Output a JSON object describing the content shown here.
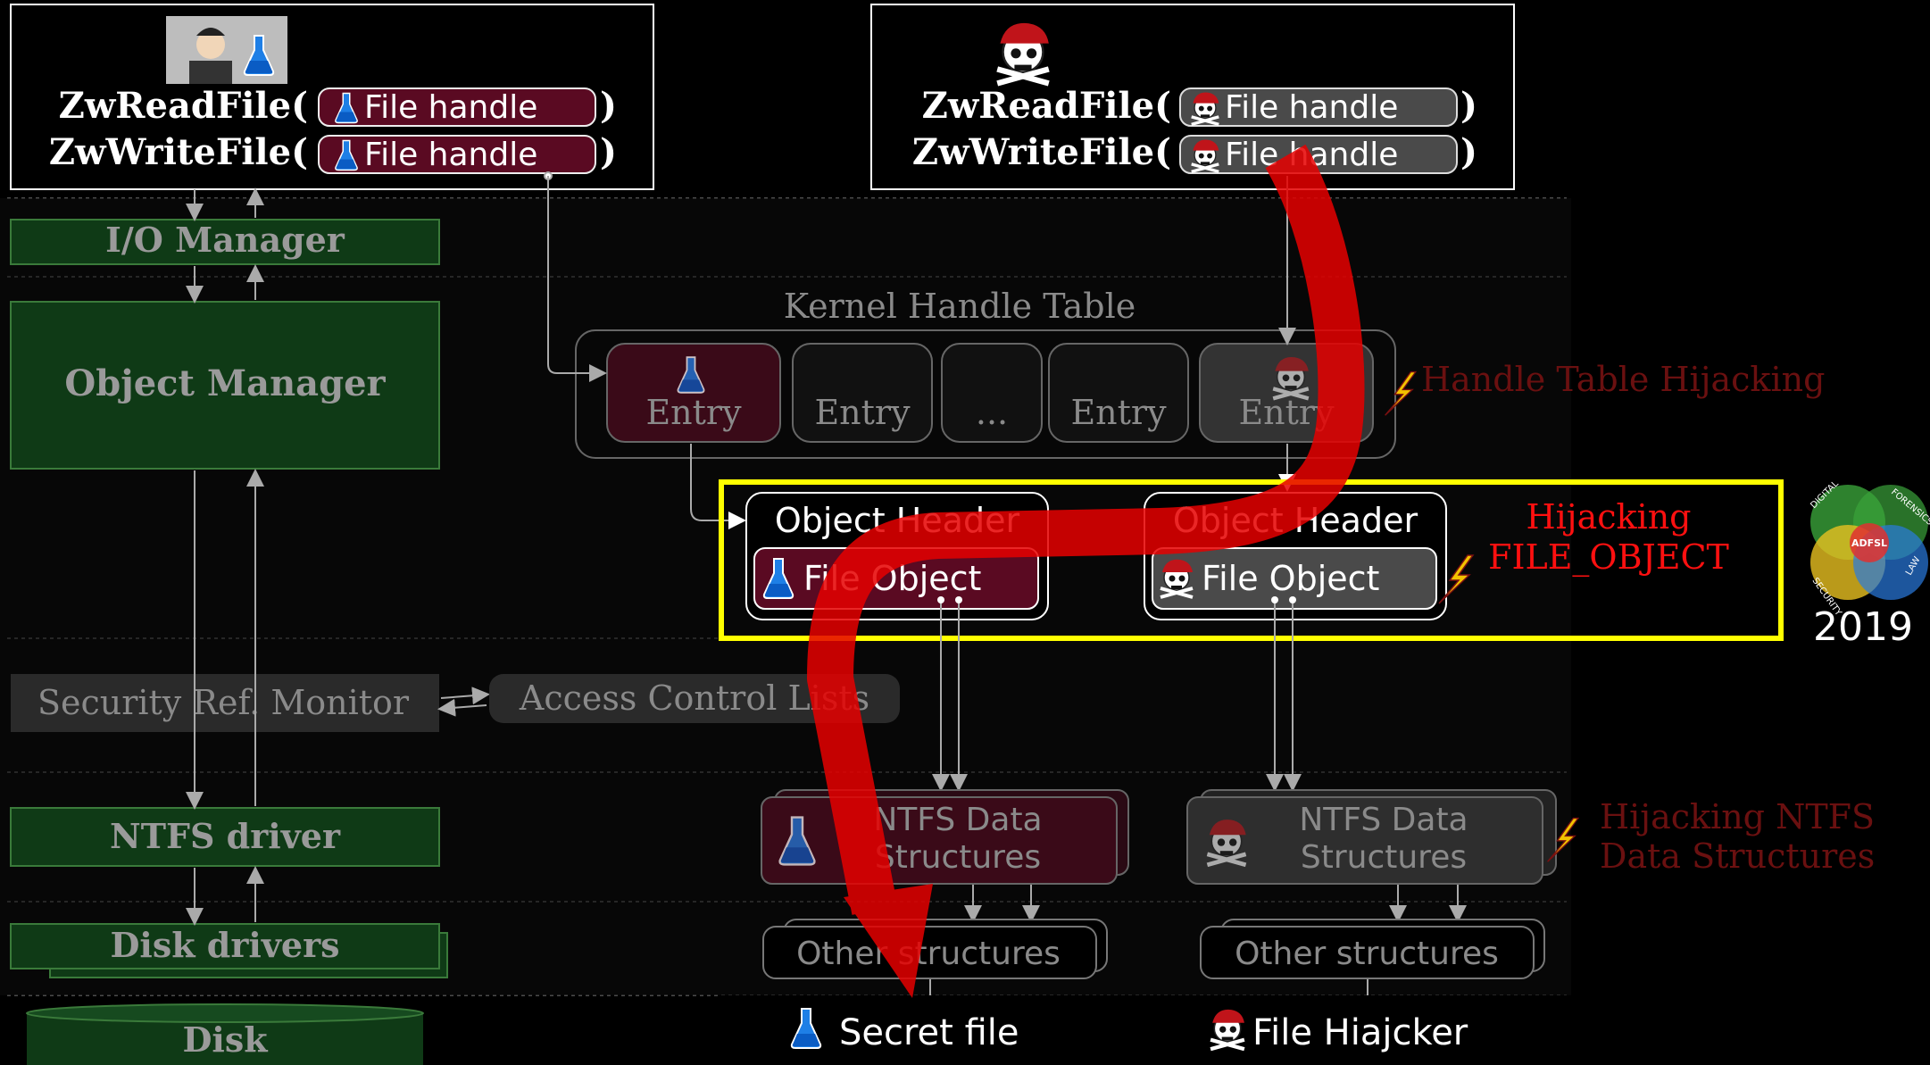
{
  "legit": {
    "read_call": "ZwReadFile(",
    "write_call": "ZwWriteFile(",
    "handle_label": "File handle",
    "close_paren": ")"
  },
  "attacker": {
    "read_call": "ZwReadFile(",
    "write_call": "ZwWriteFile(",
    "handle_label": "File handle",
    "close_paren": ")"
  },
  "layers": {
    "io_manager": "I/O Manager",
    "object_manager": "Object Manager",
    "security_monitor": "Security Ref. Monitor",
    "acl": "Access Control Lists",
    "ntfs_driver": "NTFS driver",
    "disk_drivers": "Disk drivers",
    "disk": "Disk"
  },
  "handle_table": {
    "title": "Kernel Handle Table",
    "entries": [
      "Entry",
      "Entry",
      "...",
      "Entry",
      "Entry"
    ]
  },
  "objects": {
    "header_label": "Object Header",
    "file_object_label": "File Object"
  },
  "ntfs": {
    "data_line1": "NTFS Data",
    "data_line2": "Structures",
    "other": "Other structures"
  },
  "attacks": {
    "handle_table": "Handle Table Hijacking",
    "file_object_line1": "Hijacking",
    "file_object_line2": "FILE_OBJECT",
    "ntfs_line1": "Hijacking NTFS",
    "ntfs_line2": "Data Structures"
  },
  "results": {
    "secret_file": "Secret file",
    "hijacker": "File Hiajcker"
  },
  "conference": {
    "year": "2019",
    "logo_text": "ADFSL",
    "logo_words": [
      "DIGITAL",
      "FORENSICS",
      "LAW",
      "SECURITY"
    ]
  },
  "colors": {
    "legit": "#5a0a22",
    "attacker": "#4a4a4a",
    "green_box": "#0f3a16",
    "highlight": "#ffff00",
    "red_arrow": "#e60000"
  }
}
